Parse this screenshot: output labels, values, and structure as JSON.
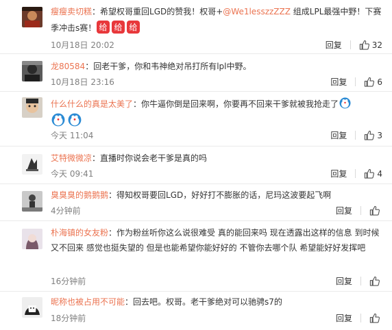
{
  "comments": [
    {
      "name": "瘦瘦卖切糕",
      "text_a": "：希望权哥重回LGD的赞我！权哥+",
      "mention": "@We1lesszzZZZ",
      "text_b": " 组成LPL最强中野！下赛季冲击s赛！",
      "time": "10月18日 20:02",
      "reply": "回复",
      "likes": "32"
    },
    {
      "name": "龙80584",
      "text_a": "：回老干爹，你和韦神绝对吊打所有lpl中野。",
      "time": "10月18日 23:16",
      "reply": "回复",
      "likes": "6"
    },
    {
      "name": "什么什么的真是太美了",
      "text_a": "：你牛逼你倒是回来啊，你要再不回来干爹就被我抢走了",
      "time": "今天 11:04",
      "reply": "回复",
      "likes": "3"
    },
    {
      "name": "艾特微微凉",
      "text_a": "：直播时你说会老干爹是真的吗",
      "time": "今天 09:41",
      "reply": "回复",
      "likes": "4"
    },
    {
      "name": "臭臭臭的鹅鹅鹅",
      "text_a": "：得知权哥要回LGD，好好打不膨胀的话，尼玛这波要起飞啊",
      "time": "4分钟前",
      "reply": "回复"
    },
    {
      "name": "朴海镇的女友粉",
      "text_a": "：作为粉丝听你这么说很难受  真的能回来吗  现在透露出这样的信息    到时候又不回来  感觉也挺失望的   但是也能希望你能好好的  不管你去哪个队  希望能好好发挥吧",
      "time": "16分钟前",
      "reply": "回复"
    },
    {
      "name": "昵称也被占用不可能",
      "text_a": "：回去吧。权哥。老干爹绝对可以驰骋s7的",
      "time": "18分钟前",
      "reply": "回复"
    }
  ],
  "colors": {
    "name": "#eb7350",
    "meta": "#808080",
    "text": "#333333",
    "divider": "#eaeaea"
  }
}
